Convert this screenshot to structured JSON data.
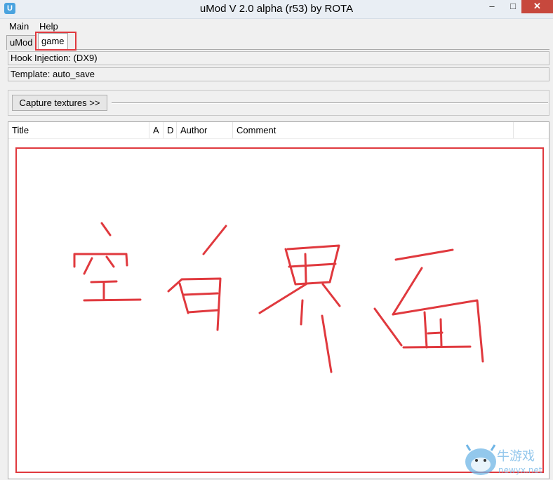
{
  "window": {
    "title": "uMod V 2.0 alpha (r53)  by  ROTA",
    "icon": "umod-app-icon",
    "controls": {
      "minimize": "–",
      "maximize": "□",
      "close": "✕"
    }
  },
  "menu": {
    "main": "Main",
    "help": "Help"
  },
  "tabs": {
    "umod": "uMod",
    "game": "game",
    "active": "game"
  },
  "info": {
    "hook_injection": "Hook Injection:  (DX9)",
    "template": "Template: auto_save"
  },
  "toolbar": {
    "capture_label": "Capture textures >>"
  },
  "list": {
    "columns": [
      "Title",
      "A",
      "D",
      "Author",
      "Comment"
    ],
    "rows": []
  },
  "annotation": {
    "handwritten_text": "空白界面",
    "color": "#e0393e"
  },
  "watermark": {
    "text": "牛游戏 newyx.net"
  }
}
